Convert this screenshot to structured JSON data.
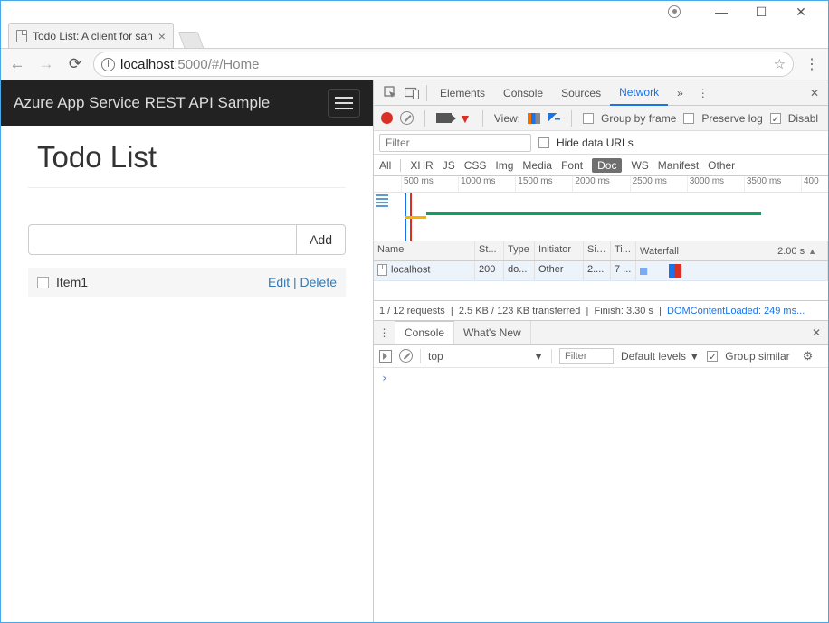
{
  "tab": {
    "title": "Todo List: A client for san"
  },
  "url": {
    "host": "localhost",
    "rest": ":5000/#/Home"
  },
  "app": {
    "brand": "Azure App Service REST API Sample",
    "heading": "Todo List",
    "add_label": "Add",
    "item": "Item1",
    "edit": "Edit",
    "delete": "Delete"
  },
  "dt": {
    "tabs": {
      "elements": "Elements",
      "console": "Console",
      "sources": "Sources",
      "network": "Network"
    },
    "toolbar": {
      "view": "View:",
      "group": "Group by frame",
      "preserve": "Preserve log",
      "disable": "Disabl"
    },
    "filter_placeholder": "Filter",
    "hide_urls": "Hide data URLs",
    "types": {
      "all": "All",
      "xhr": "XHR",
      "js": "JS",
      "css": "CSS",
      "img": "Img",
      "media": "Media",
      "font": "Font",
      "doc": "Doc",
      "ws": "WS",
      "manifest": "Manifest",
      "other": "Other"
    },
    "timeline": [
      "500 ms",
      "1000 ms",
      "1500 ms",
      "2000 ms",
      "2500 ms",
      "3000 ms",
      "3500 ms",
      "400"
    ],
    "cols": {
      "name": "Name",
      "status": "St...",
      "type": "Type",
      "initiator": "Initiator",
      "size": "Size",
      "time": "Ti...",
      "waterfall": "Waterfall",
      "scale": "2.00 s"
    },
    "row": {
      "name": "localhost",
      "status": "200",
      "type": "do...",
      "initiator": "Other",
      "size": "2....",
      "time": "7 ..."
    },
    "status": {
      "a": "1 / 12 requests",
      "b": "2.5 KB / 123 KB transferred",
      "c": "Finish: 3.30 s",
      "d": "DOMContentLoaded: 249 ms..."
    },
    "drawer": {
      "console": "Console",
      "whatsnew": "What's New"
    },
    "con": {
      "ctx": "top",
      "filter_placeholder": "Filter",
      "levels": "Default levels",
      "group_similar": "Group similar",
      "prompt": "›"
    }
  }
}
